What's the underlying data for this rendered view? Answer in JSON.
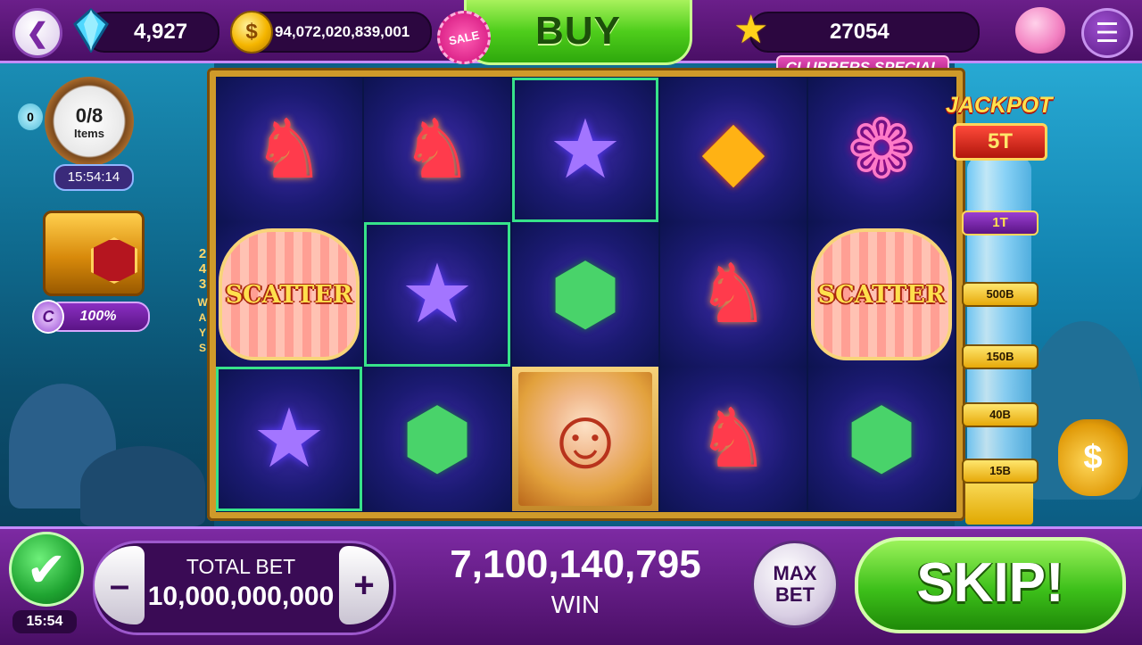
{
  "header": {
    "gems": "4,927",
    "coins": "94,072,020,839,001",
    "sale_badge": "SALE",
    "buy_label": "BUY",
    "stars": "27054",
    "promo_banner": "CLUBBERS SPECIAL"
  },
  "left_panel": {
    "bulb_count": "0",
    "quest_progress": "0/8",
    "quest_items_label": "Items",
    "quest_timer": "15:54:14",
    "chest_badge": "C",
    "chest_percent": "100%"
  },
  "reels": {
    "ways_label": "243 WAYS",
    "grid": [
      [
        "seahorse",
        "scatter",
        "starfish"
      ],
      [
        "seahorse",
        "starfish",
        "turtle"
      ],
      [
        "starfish",
        "turtle",
        "mermaid"
      ],
      [
        "fish",
        "seahorse",
        "seahorse"
      ],
      [
        "shell",
        "scatter",
        "turtle"
      ]
    ],
    "scatter_label": "SCATTER"
  },
  "jackpot": {
    "title": "JACKPOT",
    "value": "5T",
    "tiers": [
      "1T",
      "500B",
      "150B",
      "40B",
      "15B"
    ]
  },
  "footer": {
    "auto_timer": "15:54",
    "total_bet_label": "TOTAL BET",
    "total_bet_value": "10,000,000,000",
    "minus_label": "–",
    "plus_label": "+",
    "win_value": "7,100,140,795",
    "win_label": "WIN",
    "max_bet_line1": "MAX",
    "max_bet_line2": "BET",
    "skip_label": "SKIP!"
  },
  "colors": {
    "accent_purple": "#5a1485",
    "win_highlight": "#37e38a",
    "buy_green": "#4fce1c"
  }
}
